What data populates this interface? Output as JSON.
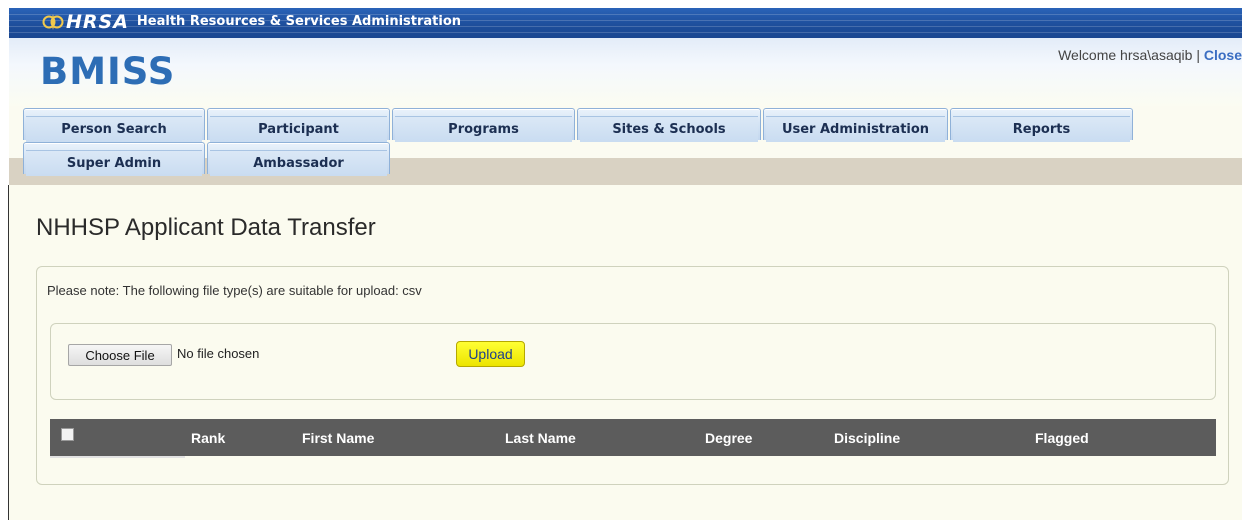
{
  "hrsa_bar": {
    "logo_text": "HRSA",
    "agency_name": "Health Resources & Services Administration",
    "emblem_icon": "hrsa-emblem-icon"
  },
  "header": {
    "app_title": "BMISS",
    "welcome_text": "Welcome hrsa\\asaqib",
    "separator": "|",
    "close_link": "Close"
  },
  "tabs": {
    "row1": [
      "Person Search",
      "Participant",
      "Programs",
      "Sites & Schools",
      "User Administration",
      "Reports"
    ],
    "row2": [
      "Super Admin",
      "Ambassador"
    ]
  },
  "main": {
    "page_title": "NHHSP Applicant Data Transfer",
    "note": "Please note: The following file type(s) are suitable for upload: csv",
    "choose_file_label": "Choose File",
    "no_file_text": "No file chosen",
    "upload_label": "Upload",
    "grid_columns": [
      "Rank",
      "First Name",
      "Last Name",
      "Degree",
      "Discipline",
      "Flagged"
    ]
  },
  "colors": {
    "hrsa_bar": "#1e4f9c",
    "app_title": "#2d6db5",
    "upload_button": "#ffff33",
    "grid_header": "#5c5c5c",
    "content_bg": "#fbfbef"
  }
}
